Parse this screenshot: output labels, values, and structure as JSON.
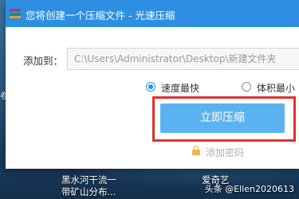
{
  "window": {
    "title": "您将创建一个压缩文件 - 光速压缩"
  },
  "form": {
    "add_to_label": "添加到：",
    "path_value": "C:\\Users\\Administrator\\Desktop\\新建文件夹"
  },
  "options": [
    {
      "label": "速度最快",
      "selected": true
    },
    {
      "label": "体积最小",
      "selected": false
    }
  ],
  "compress_button_label": "立即压缩",
  "add_password_label": "添加密码",
  "desktop": {
    "left_edge_text": "卷",
    "icon_label_1": "黑水河干流一带矿山分布...",
    "icon_label_1_line1": "黑水河干流一",
    "icon_label_1_line2": "带矿山分布...",
    "icon_label_2": "爱奇艺",
    "watermark": "头条 @Ellen2020613"
  },
  "colors": {
    "titlebar": "#2d8ee2",
    "button": "#5bb2f0",
    "highlight": "#e0312f"
  },
  "icons": {
    "app": "rar-archive-icon",
    "lock": "lock-icon"
  }
}
